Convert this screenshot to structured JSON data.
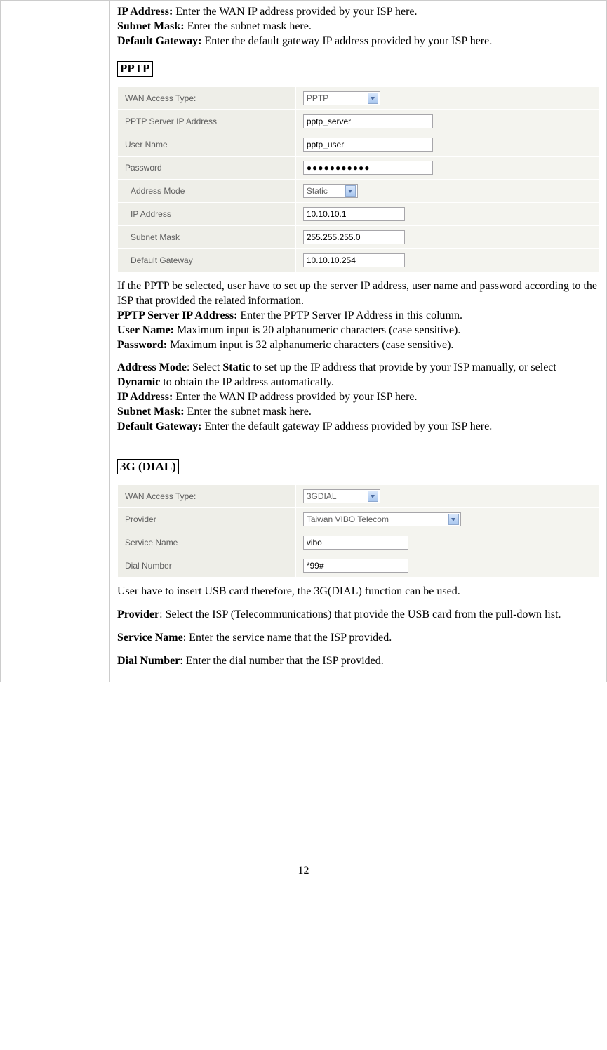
{
  "intro": {
    "ip_label": "IP Address:",
    "ip_text": " Enter the WAN IP address provided by your ISP here.",
    "subnet_label": "Subnet Mask:",
    "subnet_text": " Enter the subnet mask here.",
    "gw_label": "Default Gateway:",
    "gw_text": " Enter the default gateway IP address provided by your ISP here."
  },
  "section_pptp_heading": "PPTP",
  "pptp_form": {
    "rows": {
      "wan_label": "WAN Access Type:",
      "wan_value": "PPTP",
      "server_label": "PPTP Server IP Address",
      "server_value": "pptp_server",
      "user_label": "User Name",
      "user_value": "pptp_user",
      "pass_label": "Password",
      "pass_value": "●●●●●●●●●●●",
      "mode_label": "Address Mode",
      "mode_value": "Static",
      "ip_label": "IP Address",
      "ip_value": "10.10.10.1",
      "subnet_label": "Subnet Mask",
      "subnet_value": "255.255.255.0",
      "gw_label": "Default Gateway",
      "gw_value": "10.10.10.254"
    }
  },
  "pptp_desc": {
    "intro": "If the PPTP be selected, user have to set up the server IP address, user name and password according to the ISP that provided the related information.",
    "server_label": "PPTP Server IP Address:",
    "server_text": " Enter the PPTP Server IP Address in this column.",
    "user_label": "User Name:",
    "user_text": " Maximum input is 20 alphanumeric characters (case sensitive).",
    "pass_label": "Password:",
    "pass_text": " Maximum input is 32 alphanumeric characters (case sensitive).",
    "mode_label": "Address Mode",
    "mode_pre": ": Select ",
    "mode_static": "Static",
    "mode_mid": " to set up the IP address that provide by your ISP manually, or select ",
    "mode_dynamic": "Dynamic",
    "mode_post": " to obtain the IP address automatically.",
    "ip_label": "IP Address:",
    "ip_text": " Enter the WAN IP address provided by your ISP here.",
    "subnet_label": "Subnet Mask:",
    "subnet_text": " Enter the subnet mask here.",
    "gw_label": "Default Gateway:",
    "gw_text": " Enter the default gateway IP address provided by your ISP here."
  },
  "section_3g_heading": "3G (DIAL)",
  "dial_form": {
    "rows": {
      "wan_label": "WAN Access Type:",
      "wan_value": "3GDIAL",
      "provider_label": "Provider",
      "provider_value": "Taiwan VIBO Telecom",
      "service_label": "Service Name",
      "service_value": "vibo",
      "dial_label": "Dial Number",
      "dial_value": "*99#"
    }
  },
  "dial_desc": {
    "intro": "User have to insert USB card therefore, the 3G(DIAL) function can be used.",
    "provider_label": "Provider",
    "provider_text": ": Select the ISP (Telecommunications) that provide the USB card from the pull-down list.",
    "service_label": "Service Name",
    "service_text": ": Enter the service name that the ISP provided.",
    "dial_label": "Dial Number",
    "dial_text": ": Enter the dial number that the ISP provided."
  },
  "page_number": "12"
}
